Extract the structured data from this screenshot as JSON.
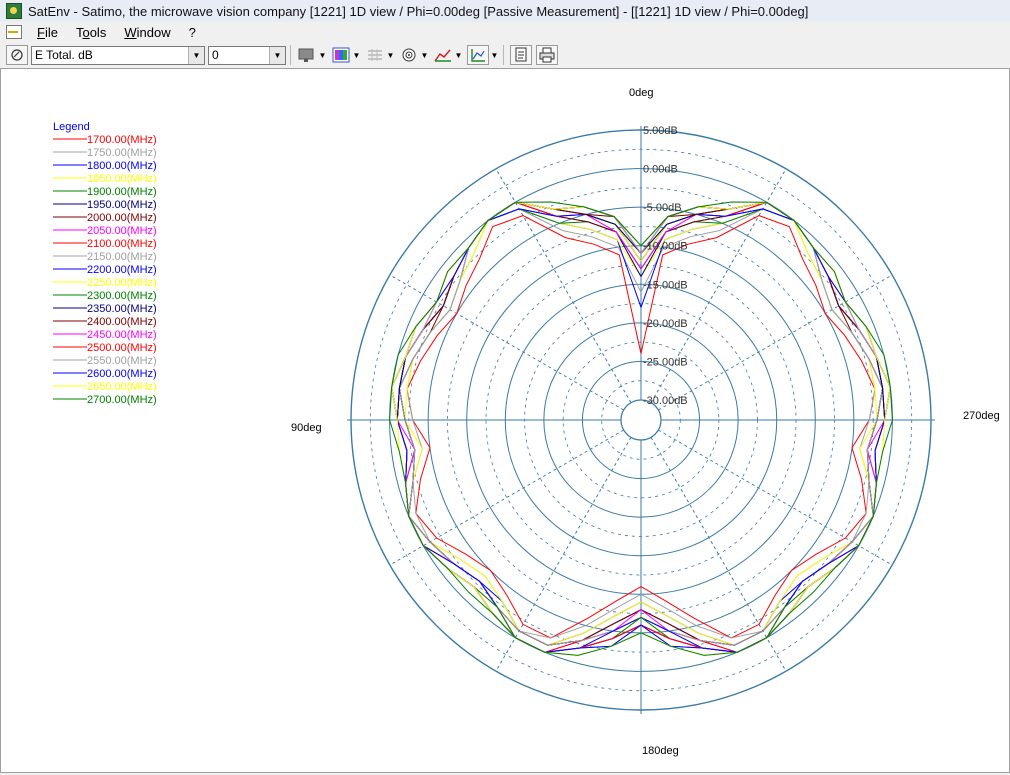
{
  "window": {
    "title": "SatEnv - Satimo, the microwave vision company [1221] 1D view / Phi=0.00deg [Passive Measurement] - [[1221] 1D view / Phi=0.00deg]"
  },
  "menu": {
    "items": [
      {
        "underline": "F",
        "rest": "ile"
      },
      {
        "pre": "T",
        "underline": "o",
        "rest": "ols"
      },
      {
        "underline": "W",
        "rest": "indow"
      },
      {
        "underline": "",
        "rest": "?"
      }
    ]
  },
  "toolbar": {
    "quantity_select": "E Total. dB",
    "index_select": "0",
    "icons": [
      "select-tool-icon",
      "color-map-icon",
      "grid-icon",
      "polar-icon",
      "line-plot-icon",
      "cartesian-icon",
      "copy-icon",
      "print-icon"
    ]
  },
  "plot": {
    "angle_labels": {
      "top": "0deg",
      "left": "90deg",
      "right": "270deg",
      "bottom": "180deg"
    },
    "ring_labels": [
      "5.00dB",
      "0.00dB",
      "-5.00dB",
      "-10.00dB",
      "-15.00dB",
      "-20.00dB",
      "-25.00dB",
      "-30.00dB"
    ],
    "ring_values": [
      5,
      0,
      -5,
      -10,
      -15,
      -20,
      -25,
      -30
    ],
    "r_max_db": 5,
    "r_min_db": -30,
    "legend_title": "Legend",
    "accent_color": "#0000ff"
  },
  "chart_data": {
    "type": "line",
    "title": "",
    "theta_unit": "deg",
    "r_unit": "dB",
    "rlim": [
      -30,
      5
    ],
    "series": [
      {
        "name": "1700.00(MHz)",
        "color": "#ff0000",
        "values": [
          -24,
          -11,
          -9,
          -7,
          -2,
          -1,
          -3,
          -4,
          -5,
          -4,
          -3,
          -2,
          -3,
          -5,
          -3,
          -1,
          -2,
          -4,
          -5,
          -4,
          -2,
          -2,
          -6,
          -9,
          -11
        ]
      },
      {
        "name": "1750.00(MHz)",
        "color": "#a0a0a0",
        "values": [
          -16,
          -10,
          -8,
          -6,
          -1,
          0,
          -2,
          -3,
          -4,
          -3,
          -2,
          -2,
          -3,
          -4,
          -2,
          -1,
          -1,
          -3,
          -4,
          -3,
          -1,
          -2,
          -5,
          -8,
          -10
        ]
      },
      {
        "name": "1800.00(MHz)",
        "color": "#0000ff",
        "values": [
          -18,
          -9,
          -7,
          -5,
          -1,
          0,
          -1,
          -3,
          -4,
          -3,
          -2,
          -1,
          -2,
          -3,
          -2,
          0,
          -1,
          -2,
          -3,
          -3,
          -1,
          -1,
          -4,
          -7,
          -9
        ]
      },
      {
        "name": "1850.00(MHz)",
        "color": "#ffff00",
        "values": [
          -14,
          -9,
          -7,
          -5,
          -1,
          0,
          -2,
          -3,
          -4,
          -3,
          -2,
          -2,
          -2,
          -4,
          -2,
          0,
          -1,
          -3,
          -4,
          -3,
          -1,
          -1,
          -4,
          -7,
          -9
        ]
      },
      {
        "name": "1900.00(MHz)",
        "color": "#008000",
        "values": [
          -13,
          -8,
          -6,
          -5,
          -1,
          0,
          -1,
          -2,
          -3,
          -2,
          -1,
          -1,
          -2,
          -3,
          -1,
          0,
          -1,
          -2,
          -3,
          -2,
          -1,
          -1,
          -3,
          -6,
          -8
        ]
      },
      {
        "name": "1950.00(MHz)",
        "color": "#000080",
        "values": [
          -14,
          -8,
          -6,
          -4,
          -1,
          0,
          -1,
          -2,
          -3,
          -2,
          -1,
          -1,
          -2,
          -3,
          -2,
          0,
          -1,
          -2,
          -3,
          -2,
          -1,
          -1,
          -3,
          -6,
          -8
        ]
      },
      {
        "name": "2000.00(MHz)",
        "color": "#800000",
        "values": [
          -13,
          -8,
          -6,
          -4,
          0,
          0,
          -1,
          -2,
          -3,
          -3,
          -2,
          -1,
          -2,
          -3,
          -2,
          0,
          -1,
          -2,
          -3,
          -2,
          -1,
          -1,
          -3,
          -6,
          -8
        ]
      },
      {
        "name": "2050.00(MHz)",
        "color": "#ff00ff",
        "values": [
          -13,
          -8,
          -5,
          -4,
          0,
          0,
          -1,
          -2,
          -3,
          -2,
          -1,
          -1,
          -1,
          -3,
          -1,
          0,
          0,
          -2,
          -3,
          -2,
          0,
          0,
          -3,
          -5,
          -8
        ]
      },
      {
        "name": "2100.00(MHz)",
        "color": "#ff0000",
        "values": [
          -12,
          -7,
          -5,
          -4,
          0,
          0,
          -1,
          -2,
          -3,
          -2,
          -1,
          -1,
          -1,
          -2,
          -1,
          0,
          0,
          -2,
          -3,
          -2,
          0,
          0,
          -3,
          -5,
          -7
        ]
      },
      {
        "name": "2150.00(MHz)",
        "color": "#a0a0a0",
        "values": [
          -12,
          -7,
          -5,
          -4,
          -1,
          0,
          -1,
          -3,
          -4,
          -3,
          -2,
          -1,
          -2,
          -3,
          -2,
          0,
          -1,
          -2,
          -3,
          -2,
          -1,
          -1,
          -3,
          -5,
          -7
        ]
      },
      {
        "name": "2200.00(MHz)",
        "color": "#0000ff",
        "values": [
          -12,
          -7,
          -5,
          -4,
          -1,
          0,
          -1,
          -2,
          -3,
          -2,
          -1,
          -1,
          -1,
          -2,
          -1,
          0,
          0,
          -2,
          -3,
          -2,
          0,
          0,
          -2,
          -5,
          -7
        ]
      },
      {
        "name": "2250.00(MHz)",
        "color": "#ffff00",
        "values": [
          -12,
          -7,
          -5,
          -3,
          0,
          0,
          -1,
          -2,
          -2,
          -2,
          -1,
          0,
          -1,
          -2,
          -1,
          0,
          0,
          -1,
          -2,
          -2,
          0,
          0,
          -2,
          -4,
          -7
        ]
      },
      {
        "name": "2300.00(MHz)",
        "color": "#008000",
        "values": [
          -11,
          -7,
          -5,
          -3,
          0,
          0,
          -1,
          -2,
          -3,
          -2,
          -1,
          -1,
          -1,
          -2,
          -1,
          0,
          0,
          -1,
          -2,
          -2,
          0,
          0,
          -2,
          -4,
          -7
        ]
      },
      {
        "name": "2350.00(MHz)",
        "color": "#000080",
        "values": [
          -11,
          -7,
          -5,
          -3,
          0,
          0,
          -1,
          -2,
          -3,
          -2,
          -1,
          -1,
          -1,
          -2,
          -1,
          0,
          0,
          -1,
          -2,
          -1,
          0,
          0,
          -2,
          -4,
          -6
        ]
      },
      {
        "name": "2400.00(MHz)",
        "color": "#800000",
        "values": [
          -11,
          -6,
          -5,
          -3,
          0,
          0,
          -1,
          -2,
          -3,
          -2,
          -1,
          0,
          -1,
          -2,
          -1,
          0,
          0,
          -1,
          -2,
          -1,
          0,
          0,
          -2,
          -4,
          -6
        ]
      },
      {
        "name": "2450.00(MHz)",
        "color": "#ff00ff",
        "values": [
          -11,
          -6,
          -4,
          -3,
          0,
          0,
          -1,
          -2,
          -2,
          -2,
          -1,
          0,
          -1,
          -2,
          -1,
          0,
          0,
          -1,
          -2,
          -1,
          0,
          0,
          -2,
          -4,
          -6
        ]
      },
      {
        "name": "2500.00(MHz)",
        "color": "#ff0000",
        "values": [
          -11,
          -6,
          -4,
          -3,
          0,
          0,
          -1,
          -1,
          -2,
          -1,
          -1,
          0,
          -1,
          -2,
          -1,
          0,
          0,
          -1,
          -2,
          -1,
          0,
          0,
          -2,
          -4,
          -6
        ]
      },
      {
        "name": "2550.00(MHz)",
        "color": "#a0a0a0",
        "values": [
          -11,
          -6,
          -4,
          -3,
          0,
          0,
          -1,
          -2,
          -2,
          -2,
          -1,
          0,
          -1,
          -2,
          -1,
          0,
          0,
          -1,
          -2,
          -1,
          0,
          0,
          -2,
          -3,
          -6
        ]
      },
      {
        "name": "2600.00(MHz)",
        "color": "#0000ff",
        "values": [
          -10,
          -6,
          -4,
          -3,
          0,
          0,
          -1,
          -2,
          -2,
          -1,
          -1,
          0,
          -1,
          -2,
          -1,
          0,
          0,
          -1,
          -2,
          -1,
          0,
          0,
          -2,
          -3,
          -6
        ]
      },
      {
        "name": "2650.00(MHz)",
        "color": "#ffff00",
        "values": [
          -10,
          -6,
          -4,
          -3,
          0,
          0,
          -1,
          -1,
          -2,
          -1,
          -1,
          0,
          -1,
          -1,
          -1,
          0,
          0,
          -1,
          -2,
          -1,
          0,
          0,
          -1,
          -3,
          -5
        ]
      },
      {
        "name": "2700.00(MHz)",
        "color": "#008000",
        "values": [
          -10,
          -6,
          -4,
          -2,
          0,
          0,
          -1,
          -1,
          -2,
          -1,
          0,
          0,
          0,
          -1,
          -1,
          0,
          0,
          -1,
          -1,
          -1,
          0,
          0,
          -1,
          -3,
          -5
        ]
      }
    ]
  }
}
